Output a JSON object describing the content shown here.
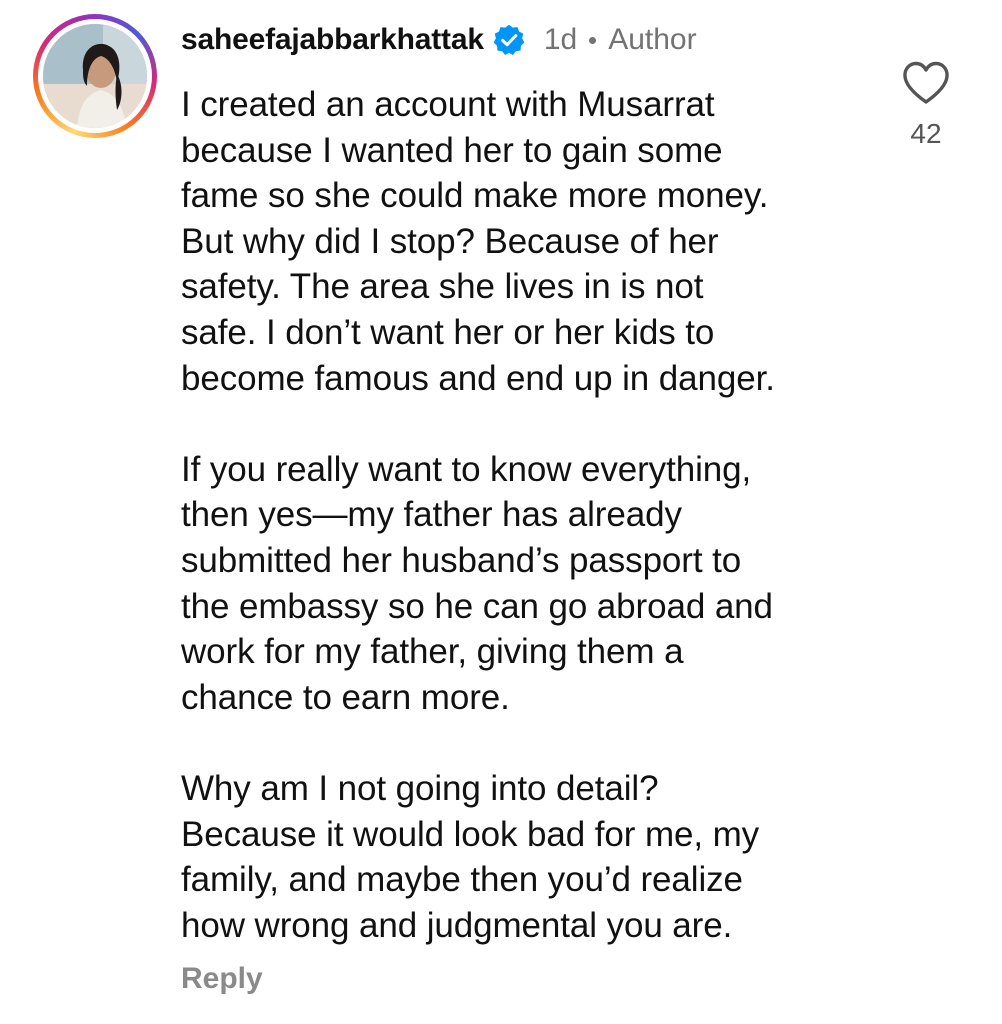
{
  "comment": {
    "username": "saheefajabbarkhattak",
    "verified_icon": "verified-badge-icon",
    "time": "1d",
    "role": "Author",
    "paragraphs": [
      "I created an account with Musarrat\nbecause I wanted her to gain some\nfame so she could make more money.\nBut why did I stop? Because of her\nsafety. The area she lives in is not\nsafe. I don’t want her or her kids to\nbecome famous and end up in danger.\n\nIf you really want to know everything,\nthen yes—my father has already\nsubmitted her husband’s passport to\nthe embassy so he can go abroad and\nwork for my father, giving them a\nchance to earn more.\n\nWhy am I not going into detail?\nBecause it would look bad for me, my\nfamily, and maybe then you’d realize\nhow wrong and judgmental you are."
    ],
    "like_count": "42",
    "like_icon": "heart-icon",
    "reply_label": "Reply"
  },
  "colors": {
    "verified": "#0095f6",
    "secondary_text": "#737373",
    "primary_text": "#111111"
  }
}
